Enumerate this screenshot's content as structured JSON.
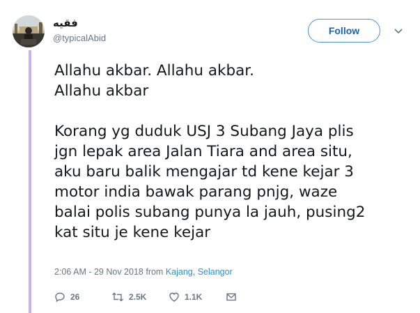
{
  "user": {
    "display_name": "فقيه",
    "handle": "@typicalAbid"
  },
  "follow": {
    "label": "Follow"
  },
  "tweet": {
    "text": "Allahu akbar. Allahu akbar.\nAllahu akbar\n\nKorang yg duduk USJ 3 Subang Jaya plis\njgn lepak area Jalan Tiara and area situ,\naku baru balik mengajar td kene kejar 3\nmotor india bawak parang pnjg, waze\nbalai polis subang punya la jauh, pusing2\nkat situ je kene kejar"
  },
  "meta": {
    "timestamp": "2:06 AM - 29 Nov 2018",
    "from_label": "from",
    "location": "Kajang, Selangor"
  },
  "actions": {
    "replies": "26",
    "retweets": "2.5K",
    "likes": "1.1K"
  },
  "colors": {
    "accent": "#1b95e0",
    "thread_line": "#c4b5f0",
    "muted": "#657786"
  }
}
